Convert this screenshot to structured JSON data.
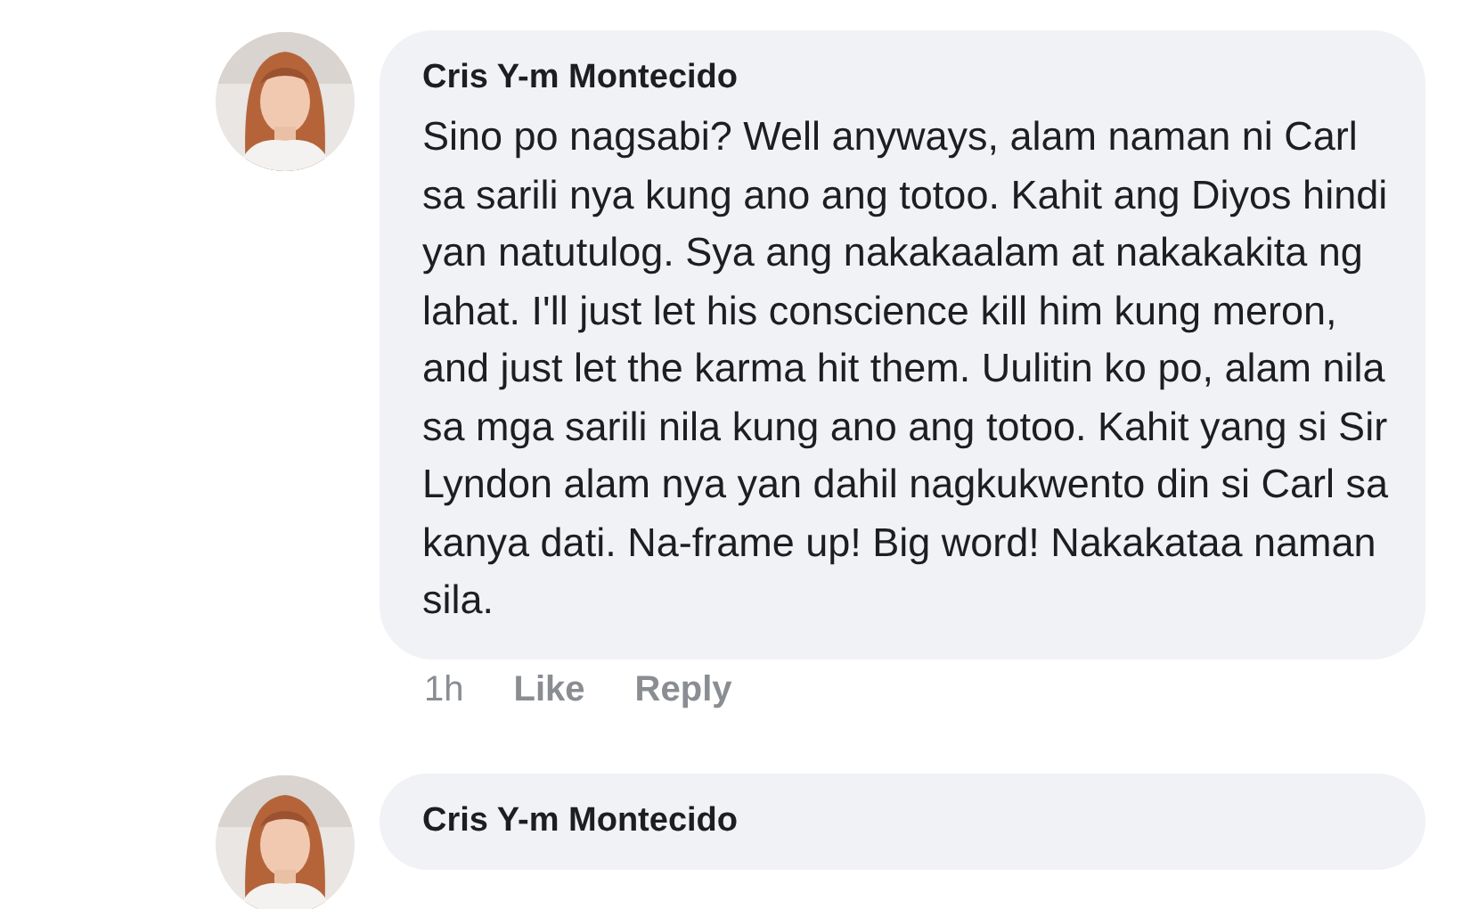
{
  "comments": [
    {
      "author": "Cris Y-m Montecido",
      "text": "Sino po nagsabi? Well anyways, alam naman ni Carl sa sarili nya kung ano ang totoo. Kahit ang Diyos hindi yan natutulog. Sya ang nakakaalam at nakakakita ng lahat. I'll just let his conscience kill him kung meron, and just let the karma hit them. Uulitin ko po, alam nila sa mga sarili nila kung ano ang totoo. Kahit yang si Sir Lyndon alam nya yan dahil nagkukwento din si Carl sa kanya dati. Na-frame up! Big word! Nakakataa naman sila.",
      "time": "1h",
      "actions": [
        "Like",
        "Reply"
      ]
    },
    {
      "author": "Cris Y-m Montecido"
    }
  ]
}
